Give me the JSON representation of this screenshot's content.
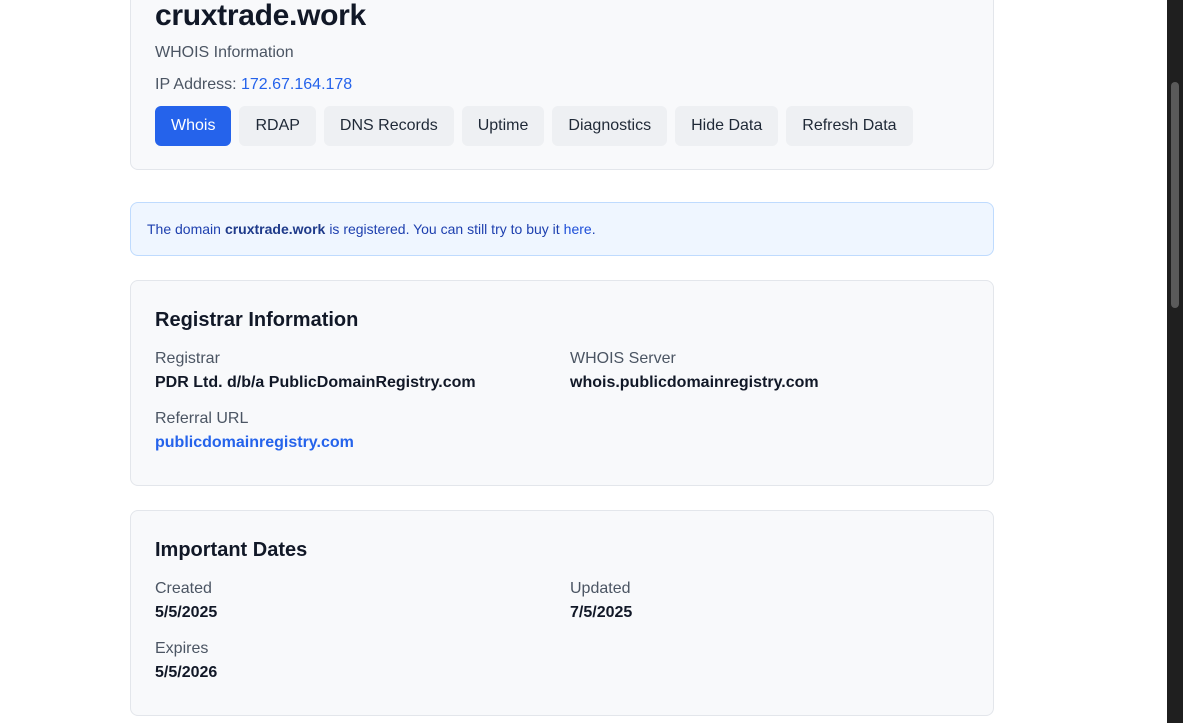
{
  "header": {
    "domain": "cruxtrade.work",
    "subtitle": "WHOIS Information",
    "ip_label": "IP Address:",
    "ip_value": "172.67.164.178"
  },
  "tabs": [
    {
      "label": "Whois",
      "active": true
    },
    {
      "label": "RDAP"
    },
    {
      "label": "DNS Records"
    },
    {
      "label": "Uptime"
    },
    {
      "label": "Diagnostics"
    },
    {
      "label": "Hide Data"
    },
    {
      "label": "Refresh Data"
    }
  ],
  "notice": {
    "prefix": "The domain",
    "domain": "cruxtrade.work",
    "middle": "is registered. You can still try to buy it",
    "link": "here",
    "suffix": "."
  },
  "registrar": {
    "title": "Registrar Information",
    "registrar_label": "Registrar",
    "registrar_value": "PDR Ltd. d/b/a PublicDomainRegistry.com",
    "whois_server_label": "WHOIS Server",
    "whois_server_value": "whois.publicdomainregistry.com",
    "referral_label": "Referral URL",
    "referral_value": "publicdomainregistry.com"
  },
  "dates": {
    "title": "Important Dates",
    "created_label": "Created",
    "created_value": "5/5/2025",
    "updated_label": "Updated",
    "updated_value": "7/5/2025",
    "expires_label": "Expires",
    "expires_value": "5/5/2026"
  },
  "colors": {
    "accent": "#2563eb",
    "notice_bg": "#eff6ff",
    "card_bg": "#f8f9fb"
  }
}
